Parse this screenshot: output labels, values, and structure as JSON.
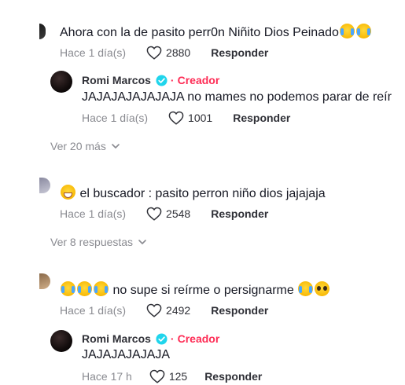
{
  "comments": [
    {
      "text": "Ahora con la de pasito perr0n Niñito Dios Peinado",
      "emoji": [
        "face-with-tears-of-joy",
        "face-with-tears-of-joy"
      ],
      "time": "Hace 1 día(s)",
      "likes": "2880",
      "reply_label": "Responder",
      "reply": {
        "author": "Romi Marcos",
        "badge": "Creador",
        "text": "JAJAJAJAJAJAJA no mames no podemos parar de reír",
        "time": "Hace 1 día(s)",
        "likes": "1001",
        "reply_label": "Responder"
      },
      "more": "Ver 20 más"
    },
    {
      "emoji_prefix": "grinning-face-with-sweat",
      "text": "el buscador : pasito perron niño dios jajajaja",
      "time": "Hace 1 día(s)",
      "likes": "2548",
      "reply_label": "Responder",
      "more": "Ver 8 respuestas"
    },
    {
      "emoji_prefix": [
        "face-with-tears-of-joy",
        "face-with-tears-of-joy",
        "face-with-tears-of-joy"
      ],
      "text": "no supe si reírme o persignarme",
      "emoji": [
        "face-with-tears-of-joy",
        "pleading-face"
      ],
      "time": "Hace 1 día(s)",
      "likes": "2492",
      "reply_label": "Responder",
      "reply": {
        "author": "Romi Marcos",
        "badge": "Creador",
        "text": "JAJAJAJAJAJA",
        "time": "Hace 17 h",
        "likes": "125",
        "reply_label": "Responder"
      }
    }
  ],
  "colors": {
    "creator": "#fe2c55",
    "verified": "#20d5ec",
    "muted": "#8a8b91",
    "text": "#161823"
  }
}
